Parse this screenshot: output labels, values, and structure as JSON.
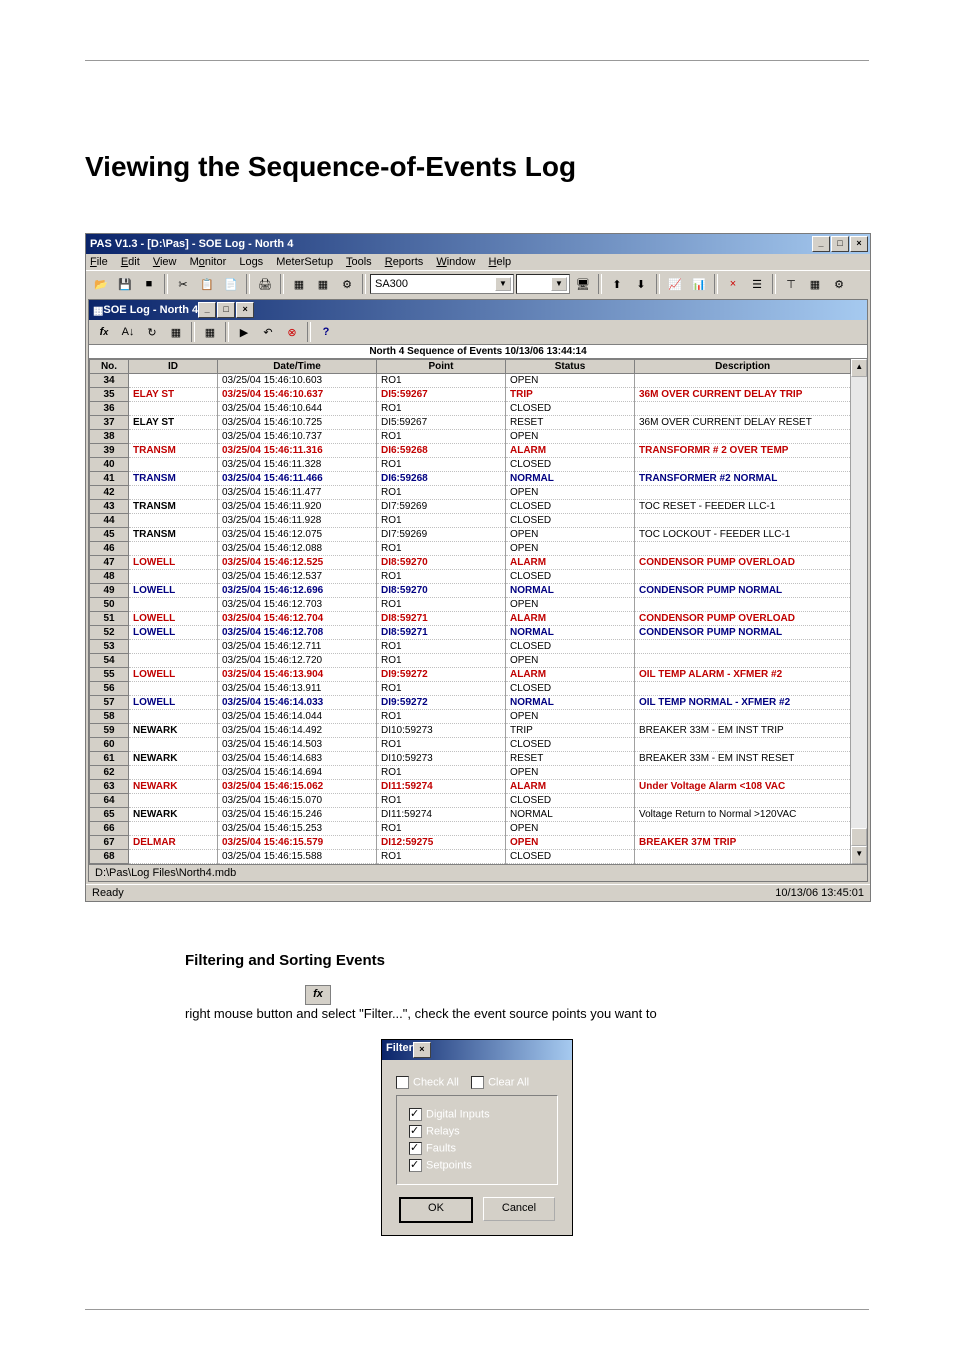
{
  "page_title": "Viewing the Sequence-of-Events Log",
  "app": {
    "title": "PAS V1.3 - [D:\\Pas] - SOE Log - North 4",
    "menus": [
      "File",
      "Edit",
      "View",
      "Monitor",
      "Logs",
      "MeterSetup",
      "Tools",
      "Reports",
      "Window",
      "Help"
    ],
    "combo_site": "SA300",
    "inner_title": "SOE Log - North 4",
    "sheet_header": "North 4  Sequence of Events  10/13/06 13:44:14",
    "columns": [
      "No.",
      "ID",
      "Date/Time",
      "Point",
      "Status",
      "Description"
    ],
    "rows": [
      {
        "no": "34",
        "id": "",
        "dt": "03/25/04 15:46:10.603",
        "pt": "RO1",
        "st": "OPEN",
        "desc": "",
        "c": "plain"
      },
      {
        "no": "35",
        "id": "ELAY ST",
        "dt": "03/25/04 15:46:10.637",
        "pt": "DI5:59267",
        "st": "TRIP",
        "desc": "36M OVER CURRENT DELAY TRIP",
        "c": "red"
      },
      {
        "no": "36",
        "id": "",
        "dt": "03/25/04 15:46:10.644",
        "pt": "RO1",
        "st": "CLOSED",
        "desc": "",
        "c": "plain"
      },
      {
        "no": "37",
        "id": "ELAY ST",
        "dt": "03/25/04 15:46:10.725",
        "pt": "DI5:59267",
        "st": "RESET",
        "desc": "36M OVER CURRENT DELAY RESET",
        "c": "plain"
      },
      {
        "no": "38",
        "id": "",
        "dt": "03/25/04 15:46:10.737",
        "pt": "RO1",
        "st": "OPEN",
        "desc": "",
        "c": "plain"
      },
      {
        "no": "39",
        "id": "TRANSM",
        "dt": "03/25/04 15:46:11.316",
        "pt": "DI6:59268",
        "st": "ALARM",
        "desc": "TRANSFORMR # 2 OVER TEMP",
        "c": "red"
      },
      {
        "no": "40",
        "id": "",
        "dt": "03/25/04 15:46:11.328",
        "pt": "RO1",
        "st": "CLOSED",
        "desc": "",
        "c": "plain"
      },
      {
        "no": "41",
        "id": "TRANSM",
        "dt": "03/25/04 15:46:11.466",
        "pt": "DI6:59268",
        "st": "NORMAL",
        "desc": "TRANSFORMER #2 NORMAL",
        "c": "blue"
      },
      {
        "no": "42",
        "id": "",
        "dt": "03/25/04 15:46:11.477",
        "pt": "RO1",
        "st": "OPEN",
        "desc": "",
        "c": "plain"
      },
      {
        "no": "43",
        "id": "TRANSM",
        "dt": "03/25/04 15:46:11.920",
        "pt": "DI7:59269",
        "st": "CLOSED",
        "desc": "TOC RESET - FEEDER LLC-1",
        "c": "plain"
      },
      {
        "no": "44",
        "id": "",
        "dt": "03/25/04 15:46:11.928",
        "pt": "RO1",
        "st": "CLOSED",
        "desc": "",
        "c": "plain"
      },
      {
        "no": "45",
        "id": "TRANSM",
        "dt": "03/25/04 15:46:12.075",
        "pt": "DI7:59269",
        "st": "OPEN",
        "desc": "TOC LOCKOUT - FEEDER LLC-1",
        "c": "plain"
      },
      {
        "no": "46",
        "id": "",
        "dt": "03/25/04 15:46:12.088",
        "pt": "RO1",
        "st": "OPEN",
        "desc": "",
        "c": "plain"
      },
      {
        "no": "47",
        "id": "LOWELL",
        "dt": "03/25/04 15:46:12.525",
        "pt": "DI8:59270",
        "st": "ALARM",
        "desc": "CONDENSOR PUMP OVERLOAD",
        "c": "red"
      },
      {
        "no": "48",
        "id": "",
        "dt": "03/25/04 15:46:12.537",
        "pt": "RO1",
        "st": "CLOSED",
        "desc": "",
        "c": "plain"
      },
      {
        "no": "49",
        "id": "LOWELL",
        "dt": "03/25/04 15:46:12.696",
        "pt": "DI8:59270",
        "st": "NORMAL",
        "desc": "CONDENSOR PUMP NORMAL",
        "c": "blue"
      },
      {
        "no": "50",
        "id": "",
        "dt": "03/25/04 15:46:12.703",
        "pt": "RO1",
        "st": "OPEN",
        "desc": "",
        "c": "plain"
      },
      {
        "no": "51",
        "id": "LOWELL",
        "dt": "03/25/04 15:46:12.704",
        "pt": "DI8:59271",
        "st": "ALARM",
        "desc": "CONDENSOR PUMP OVERLOAD",
        "c": "red"
      },
      {
        "no": "52",
        "id": "LOWELL",
        "dt": "03/25/04 15:46:12.708",
        "pt": "DI8:59271",
        "st": "NORMAL",
        "desc": "CONDENSOR PUMP NORMAL",
        "c": "blue"
      },
      {
        "no": "53",
        "id": "",
        "dt": "03/25/04 15:46:12.711",
        "pt": "RO1",
        "st": "CLOSED",
        "desc": "",
        "c": "plain"
      },
      {
        "no": "54",
        "id": "",
        "dt": "03/25/04 15:46:12.720",
        "pt": "RO1",
        "st": "OPEN",
        "desc": "",
        "c": "plain"
      },
      {
        "no": "55",
        "id": "LOWELL",
        "dt": "03/25/04 15:46:13.904",
        "pt": "DI9:59272",
        "st": "ALARM",
        "desc": "OIL TEMP ALARM - XFMER #2",
        "c": "red"
      },
      {
        "no": "56",
        "id": "",
        "dt": "03/25/04 15:46:13.911",
        "pt": "RO1",
        "st": "CLOSED",
        "desc": "",
        "c": "plain"
      },
      {
        "no": "57",
        "id": "LOWELL",
        "dt": "03/25/04 15:46:14.033",
        "pt": "DI9:59272",
        "st": "NORMAL",
        "desc": "OIL TEMP NORMAL - XFMER #2",
        "c": "blue"
      },
      {
        "no": "58",
        "id": "",
        "dt": "03/25/04 15:46:14.044",
        "pt": "RO1",
        "st": "OPEN",
        "desc": "",
        "c": "plain"
      },
      {
        "no": "59",
        "id": "NEWARK",
        "dt": "03/25/04 15:46:14.492",
        "pt": "DI10:59273",
        "st": "TRIP",
        "desc": "BREAKER 33M - EM INST TRIP",
        "c": "plain"
      },
      {
        "no": "60",
        "id": "",
        "dt": "03/25/04 15:46:14.503",
        "pt": "RO1",
        "st": "CLOSED",
        "desc": "",
        "c": "plain"
      },
      {
        "no": "61",
        "id": "NEWARK",
        "dt": "03/25/04 15:46:14.683",
        "pt": "DI10:59273",
        "st": "RESET",
        "desc": "BREAKER 33M - EM INST RESET",
        "c": "plain"
      },
      {
        "no": "62",
        "id": "",
        "dt": "03/25/04 15:46:14.694",
        "pt": "RO1",
        "st": "OPEN",
        "desc": "",
        "c": "plain"
      },
      {
        "no": "63",
        "id": "NEWARK",
        "dt": "03/25/04 15:46:15.062",
        "pt": "DI11:59274",
        "st": "ALARM",
        "desc": "Under Voltage Alarm <108 VAC",
        "c": "red"
      },
      {
        "no": "64",
        "id": "",
        "dt": "03/25/04 15:46:15.070",
        "pt": "RO1",
        "st": "CLOSED",
        "desc": "",
        "c": "plain"
      },
      {
        "no": "65",
        "id": "NEWARK",
        "dt": "03/25/04 15:46:15.246",
        "pt": "DI11:59274",
        "st": "NORMAL",
        "desc": "Voltage Return to Normal >120VAC",
        "c": "plain"
      },
      {
        "no": "66",
        "id": "",
        "dt": "03/25/04 15:46:15.253",
        "pt": "RO1",
        "st": "OPEN",
        "desc": "",
        "c": "plain"
      },
      {
        "no": "67",
        "id": "DELMAR",
        "dt": "03/25/04 15:46:15.579",
        "pt": "DI12:59275",
        "st": "OPEN",
        "desc": "BREAKER 37M TRIP",
        "c": "red"
      },
      {
        "no": "68",
        "id": "",
        "dt": "03/25/04 15:46:15.588",
        "pt": "RO1",
        "st": "CLOSED",
        "desc": "",
        "c": "plain"
      }
    ],
    "path": "D:\\Pas\\Log Files\\North4.mdb",
    "status_left": "Ready",
    "status_right": "10/13/06 13:45:01"
  },
  "section_sub": "Filtering and Sorting Events",
  "fx_label": "fx",
  "body_text": "right mouse button and select \"Filter...\", check the event source points you want to",
  "filter": {
    "title": "Filter",
    "check_all": "Check All",
    "clear_all": "Clear All",
    "items": [
      "Digital Inputs",
      "Relays",
      "Faults",
      "Setpoints"
    ],
    "ok": "OK",
    "cancel": "Cancel"
  }
}
